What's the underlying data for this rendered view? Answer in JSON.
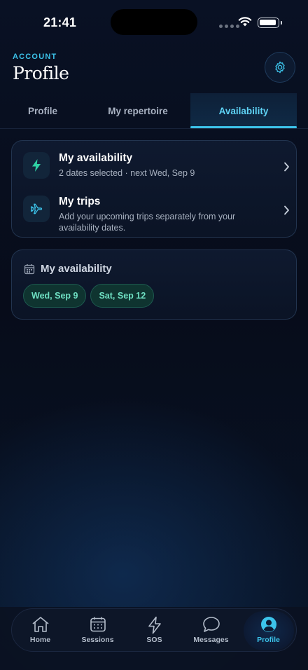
{
  "status_bar": {
    "time": "21:41"
  },
  "header": {
    "eyebrow": "ACCOUNT",
    "title": "Profile"
  },
  "tabs": [
    {
      "label": "Profile",
      "active": false
    },
    {
      "label": "My repertoire",
      "active": false
    },
    {
      "label": "Availability",
      "active": true
    }
  ],
  "links_card": {
    "availability": {
      "icon": "lightning-icon",
      "title": "My availability",
      "subtitle": "2 dates selected · next Wed, Sep 9"
    },
    "trips": {
      "icon": "airplane-icon",
      "title": "My trips",
      "subtitle": "Add your upcoming trips separately from your availability dates."
    }
  },
  "dates_card": {
    "icon": "calendar-icon",
    "title": "My availability",
    "dates": [
      "Wed, Sep 9",
      "Sat, Sep 12"
    ]
  },
  "nav": [
    {
      "label": "Home",
      "icon": "home-icon"
    },
    {
      "label": "Sessions",
      "icon": "calendar-grid-icon"
    },
    {
      "label": "SOS",
      "icon": "lightning-icon"
    },
    {
      "label": "Messages",
      "icon": "chat-bubble-icon"
    },
    {
      "label": "Profile",
      "icon": "user-circle-icon",
      "active": true
    }
  ],
  "colors": {
    "accent": "#3cc3ea",
    "date_pill_text": "#6fe0c3",
    "background": "#070d1c"
  }
}
